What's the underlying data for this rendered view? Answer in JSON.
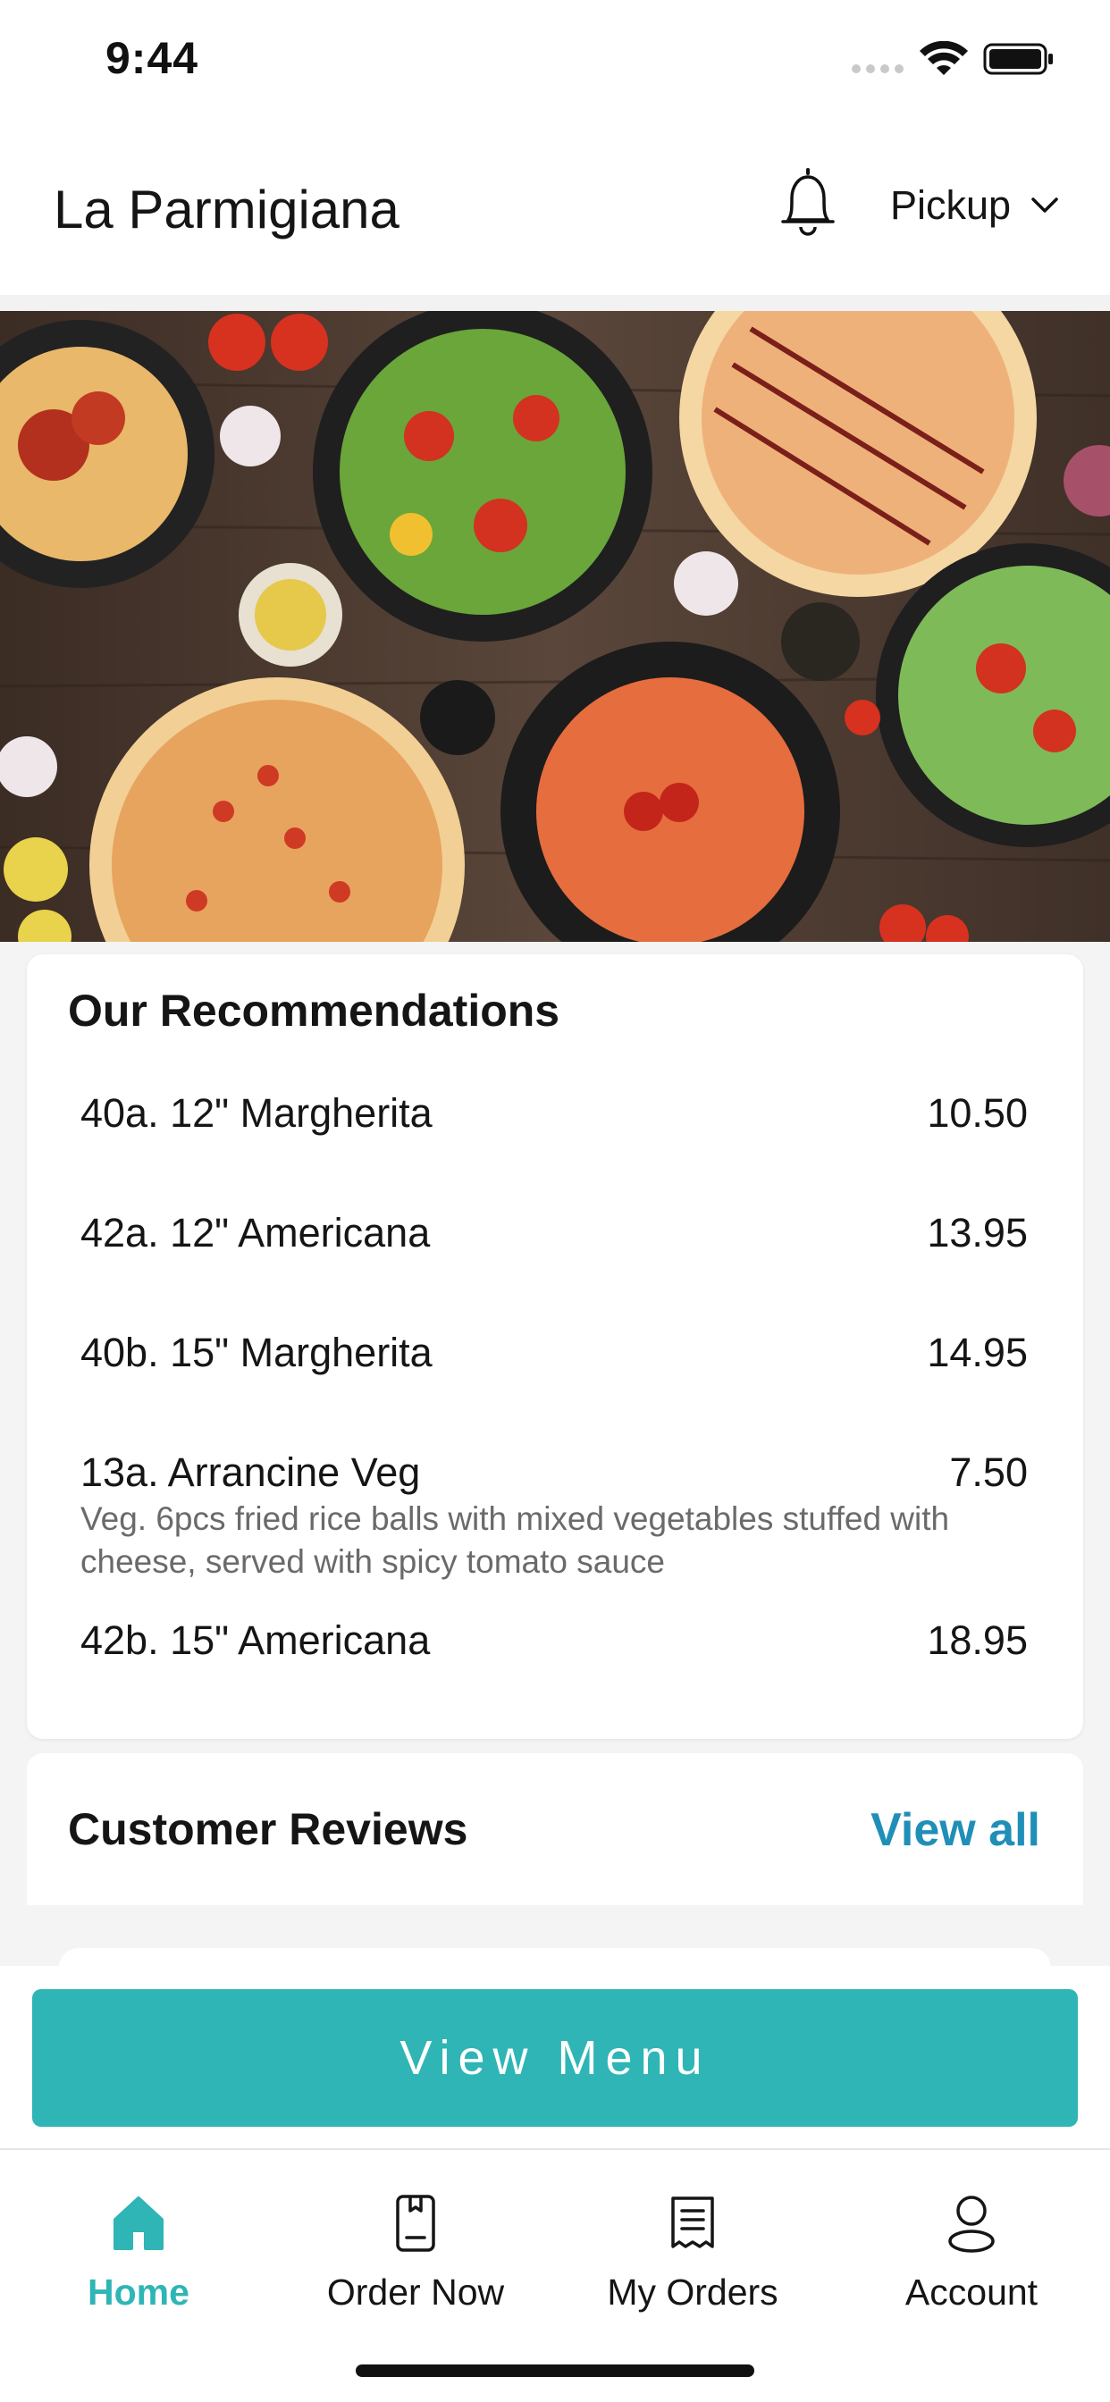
{
  "status_bar": {
    "time": "9:44"
  },
  "header": {
    "title": "La Parmigiana",
    "bell_icon": "bell-icon",
    "mode": "Pickup"
  },
  "hero": {
    "description_icon": "food-banner-image"
  },
  "recommendations": {
    "title": "Our Recommendations",
    "items": [
      {
        "name": "40a. 12\" Margherita",
        "price": "10.50",
        "description": ""
      },
      {
        "name": "42a. 12\" Americana",
        "price": "13.95",
        "description": ""
      },
      {
        "name": "40b. 15\" Margherita",
        "price": "14.95",
        "description": ""
      },
      {
        "name": "13a. Arrancine Veg",
        "price": "7.50",
        "description": "Veg. 6pcs fried rice balls with mixed vegetables stuffed with cheese, served with spicy tomato sauce"
      },
      {
        "name": "42b. 15\" Americana",
        "price": "18.95",
        "description": ""
      }
    ]
  },
  "reviews": {
    "title": "Customer Reviews",
    "view_all": "View all"
  },
  "cta": {
    "label": "View Menu"
  },
  "nav": {
    "items": [
      {
        "label": "Home",
        "icon": "home-icon",
        "active": true
      },
      {
        "label": "Order Now",
        "icon": "order-icon",
        "active": false
      },
      {
        "label": "My Orders",
        "icon": "receipt-icon",
        "active": false
      },
      {
        "label": "Account",
        "icon": "user-icon",
        "active": false
      }
    ]
  },
  "colors": {
    "accent": "#2fb5b5",
    "link": "#1f8fb8",
    "text": "#151515",
    "muted": "#6a6a6a"
  }
}
